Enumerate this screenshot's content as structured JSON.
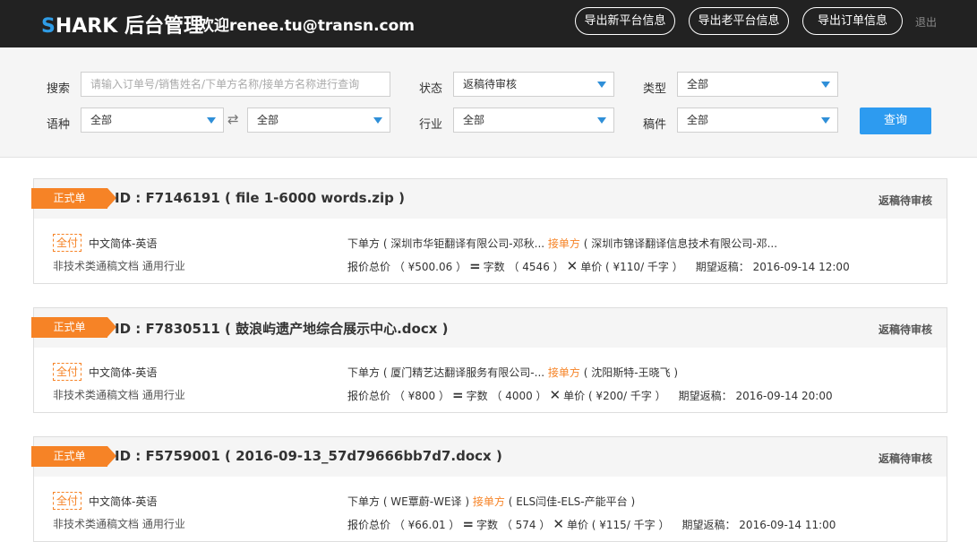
{
  "header": {
    "brand_first": "S",
    "brand_rest": "HARK 后台管理",
    "welcome": "欢迎renee.tu@transn.com",
    "buttons": [
      "导出新平台信息",
      "导出老平台信息",
      "导出订单信息"
    ],
    "logout": "退出"
  },
  "filter": {
    "search_label": "搜索",
    "search_placeholder": "请输入订单号/销售姓名/下单方名称/接单方名称进行查询",
    "status_label": "状态",
    "status_value": "返稿待审核",
    "type_label": "类型",
    "type_value": "全部",
    "language_label": "语种",
    "source_lang_value": "全部",
    "target_lang_value": "全部",
    "industry_label": "行业",
    "industry_value": "全部",
    "manuscript_label": "稿件",
    "manuscript_value": "全部",
    "query_button": "查询"
  },
  "orders": [
    {
      "tag": "正式单",
      "id_text": "ID : F7146191 ( file 1-6000 words.zip )",
      "status": "返稿待审核",
      "pay": "全付",
      "lang": "中文简体-英语",
      "category": "非技术类通稿文档  通用行业",
      "client": "下单方 ( 深圳市华钜翻译有限公司-邓秋...",
      "vendor_label": "接单方",
      "vendor": " ( 深圳市锦译翻译信息技术有限公司-邓...",
      "total": "报价总价 （ ¥500.06 ）",
      "words": "字数 （ 4546 ）",
      "unit": "单价 ( ¥110/ 千字 ）",
      "deadline": "期望返稿： 2016-09-14 12:00"
    },
    {
      "tag": "正式单",
      "id_text": "ID : F7830511 ( 鼓浪屿遗产地综合展示中心.docx )",
      "status": "返稿待审核",
      "pay": "全付",
      "lang": "中文简体-英语",
      "category": "非技术类通稿文档  通用行业",
      "client": "下单方 ( 厦门精艺达翻译服务有限公司-...",
      "vendor_label": "接单方",
      "vendor": " ( 沈阳斯特-王晓飞 )",
      "total": "报价总价 （ ¥800 ）",
      "words": "字数 （ 4000 ）",
      "unit": "单价 ( ¥200/ 千字 ）",
      "deadline": "期望返稿： 2016-09-14 20:00"
    },
    {
      "tag": "正式单",
      "id_text": "ID : F5759001 ( 2016-09-13_57d79666bb7d7.docx )",
      "status": "返稿待审核",
      "pay": "全付",
      "lang": "中文简体-英语",
      "category": "非技术类通稿文档  通用行业",
      "client": "下单方 ( WE覃蔚-WE译 )",
      "vendor_label": "接单方",
      "vendor": " ( ELS闫佳-ELS-产能平台 )",
      "total": "报价总价 （ ¥66.01 ）",
      "words": "字数 （ 574 ）",
      "unit": "单价 ( ¥115/ 千字 ）",
      "deadline": "期望返稿： 2016-09-14 11:00"
    }
  ],
  "colors": {
    "header_bg": "#222222",
    "brand_accent": "#2f9ce6",
    "orange": "#f68326",
    "query_blue": "#2d9bf0"
  }
}
